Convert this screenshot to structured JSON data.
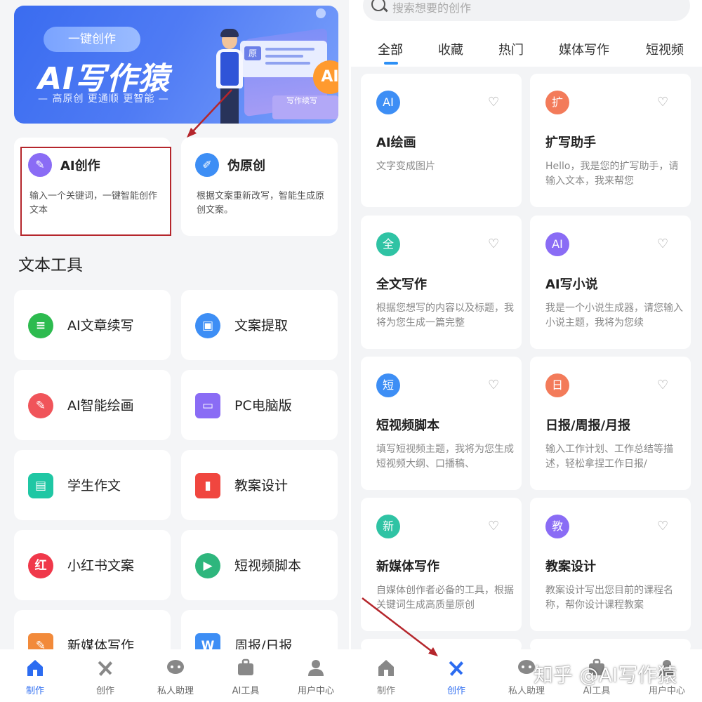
{
  "banner": {
    "tag": "一键创作",
    "title": "AI写作猿",
    "subtitle": "— 高原创  更通顺  更智能 —",
    "card_label": "原",
    "ai_badge": "AI",
    "card2_label": "写作续写"
  },
  "features": [
    {
      "title": "AI创作",
      "desc": "输入一个关键词，一键智能创作文本",
      "icon": "pen-icon",
      "color": "#8a6cf5"
    },
    {
      "title": "伪原创",
      "desc": "根据文案重新改写，智能生成原创文案。",
      "icon": "edit-icon",
      "color": "#3d8ef5"
    }
  ],
  "section_title": "文本工具",
  "tools": [
    {
      "label": "AI文章续写",
      "glyph": "≡",
      "color": "#2dbb4f",
      "icon": "doc-icon"
    },
    {
      "label": "文案提取",
      "glyph": "▣",
      "color": "#3d8ef5",
      "icon": "extract-icon"
    },
    {
      "label": "AI智能绘画",
      "glyph": "✎",
      "color": "#f0545a",
      "icon": "palette-icon"
    },
    {
      "label": "PC电脑版",
      "glyph": "▭",
      "color": "#8a6cf5",
      "icon": "laptop-icon"
    },
    {
      "label": "学生作文",
      "glyph": "▤",
      "color": "#1fc7a4",
      "icon": "essay-icon"
    },
    {
      "label": "教案设计",
      "glyph": "▮",
      "color": "#f0463f",
      "icon": "bookmark-icon"
    },
    {
      "label": "小红书文案",
      "glyph": "红",
      "color": "#f0384a",
      "icon": "xiaohongshu-icon"
    },
    {
      "label": "短视频脚本",
      "glyph": "▶",
      "color": "#2eb67d",
      "icon": "video-icon"
    },
    {
      "label": "新媒体写作",
      "glyph": "✎",
      "color": "#f28a3a",
      "icon": "media-write-icon"
    },
    {
      "label": "周报/日报",
      "glyph": "W",
      "color": "#3d8ef5",
      "icon": "report-icon"
    }
  ],
  "nav": [
    {
      "label": "制作",
      "icon": "home-icon"
    },
    {
      "label": "创作",
      "icon": "create-icon"
    },
    {
      "label": "私人助理",
      "icon": "chat-icon"
    },
    {
      "label": "AI工具",
      "icon": "toolbox-icon"
    },
    {
      "label": "用户中心",
      "icon": "user-icon"
    }
  ],
  "search": {
    "placeholder": "搜索想要的创作"
  },
  "tabs": [
    "全部",
    "收藏",
    "热门",
    "媒体写作",
    "短视频"
  ],
  "cards": [
    {
      "badge": "AI",
      "color": "#3d8ef5",
      "title": "AI绘画",
      "desc": "文字变成图片"
    },
    {
      "badge": "扩",
      "color": "#f37b5a",
      "title": "扩写助手",
      "desc": "Hello，我是您的扩写助手，请输入文本，我来帮您"
    },
    {
      "badge": "全",
      "color": "#2fc3a4",
      "title": "全文写作",
      "desc": "根据您想写的内容以及标题，我将为您生成一篇完整"
    },
    {
      "badge": "AI",
      "color": "#8a6cf5",
      "title": "AI写小说",
      "desc": "我是一个小说生成器，请您输入小说主题，我将为您续"
    },
    {
      "badge": "短",
      "color": "#3d8ef5",
      "title": "短视频脚本",
      "desc": "填写短视频主题，我将为您生成短视频大纲、口播稿、"
    },
    {
      "badge": "日",
      "color": "#f37b5a",
      "title": "日报/周报/月报",
      "desc": "输入工作计划、工作总结等描述，轻松拿捏工作日报/"
    },
    {
      "badge": "新",
      "color": "#2fc3a4",
      "title": "新媒体写作",
      "desc": "自媒体创作者必备的工具，根据关键词生成高质量原创"
    },
    {
      "badge": "教",
      "color": "#8a6cf5",
      "title": "教案设计",
      "desc": "教案设计写出您目前的课程名称，帮你设计课程教案"
    }
  ],
  "watermark": "知乎 @AI写作猿",
  "colors": {
    "accent": "#2c6cf1",
    "annotation": "#b5262c"
  }
}
